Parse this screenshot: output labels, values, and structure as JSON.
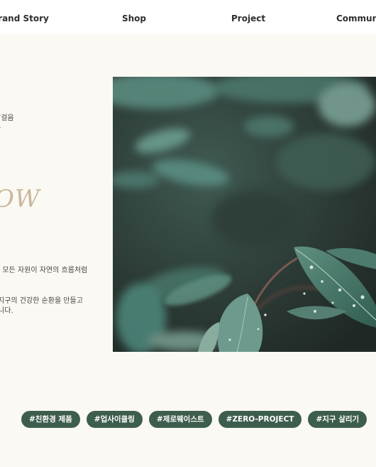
{
  "nav": {
    "items": [
      "Brand Story",
      "Shop",
      "Project",
      "Community"
    ]
  },
  "intro": {
    "line1": "발걸음",
    "line2": "속"
  },
  "headline": "OW",
  "body": {
    "line1": ", 모든 자원이 자연의 흐름처럼",
    "line2": "지구의 건강한 순환을 만들고",
    "line3": "니다."
  },
  "tags": [
    "#친환경 제품",
    "#업사이클링",
    "#제로웨이스트",
    "#ZERO-PROJECT",
    "#지구 살리기"
  ],
  "colors": {
    "background": "#fbf9f4",
    "tag_background": "#3e5e4d",
    "headline": "#c8b79a"
  }
}
